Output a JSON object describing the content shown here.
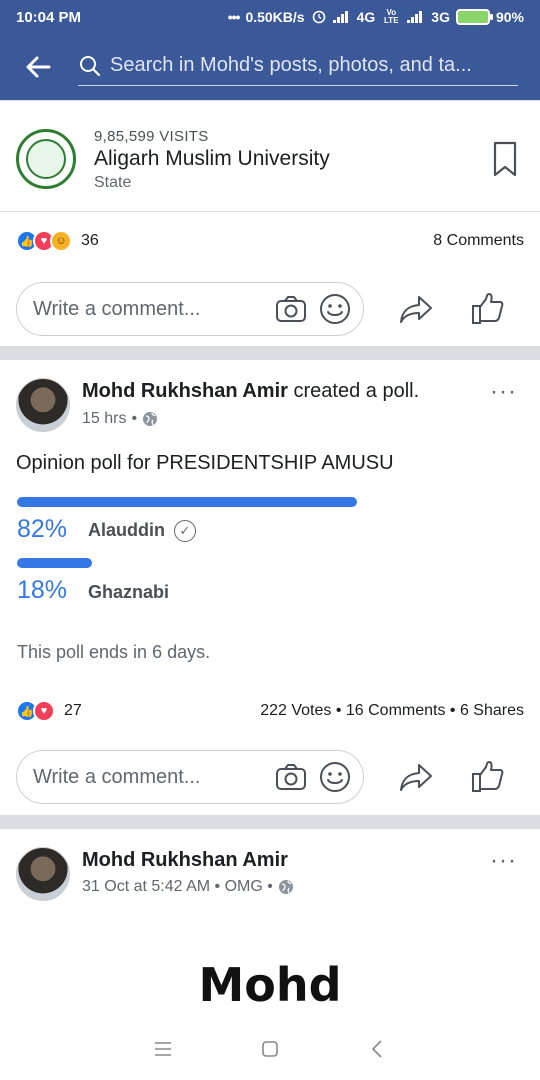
{
  "status_bar": {
    "time": "10:04 PM",
    "speed": "0.50KB/s",
    "network1": "4G",
    "volte": "Vo LTE",
    "network2": "3G",
    "battery": "90%"
  },
  "header": {
    "search_placeholder": "Search in Mohd's posts, photos, and ta..."
  },
  "page_card": {
    "visits": "9,85,599 VISITS",
    "name": "Aligarh Muslim University",
    "type": "State"
  },
  "first_post_footer": {
    "reaction_count": "36",
    "comments": "8 Comments",
    "comment_placeholder": "Write a comment..."
  },
  "poll_post": {
    "author": "Mohd Rukhshan Amir",
    "action": "created a poll.",
    "time": "15 hrs",
    "separator": "•",
    "question": "Opinion poll for PRESIDENTSHIP AMUSU",
    "options": [
      {
        "percent_label": "82%",
        "name": "Alauddin",
        "value": 82,
        "voted": true
      },
      {
        "percent_label": "18%",
        "name": "Ghaznabi",
        "value": 18,
        "voted": false
      }
    ],
    "ends": "This poll ends in 6 days.",
    "reaction_count": "27",
    "stats": "222 Votes • 16 Comments • 6 Shares",
    "comment_placeholder": "Write a comment..."
  },
  "next_post": {
    "author": "Mohd Rukhshan Amir",
    "meta": "31 Oct at 5:42 AM • OMG •",
    "image_text": "Mohd"
  },
  "icons": {
    "back": "arrow-left-icon",
    "search": "search-icon",
    "bookmark": "bookmark-icon",
    "camera": "camera-icon",
    "smiley": "smiley-icon",
    "share": "share-arrow-icon",
    "like": "thumbs-up-icon",
    "globe": "globe-icon",
    "more": "more-dots-icon"
  },
  "colors": {
    "brand": "#3b5998",
    "poll_accent": "#3578e5"
  }
}
